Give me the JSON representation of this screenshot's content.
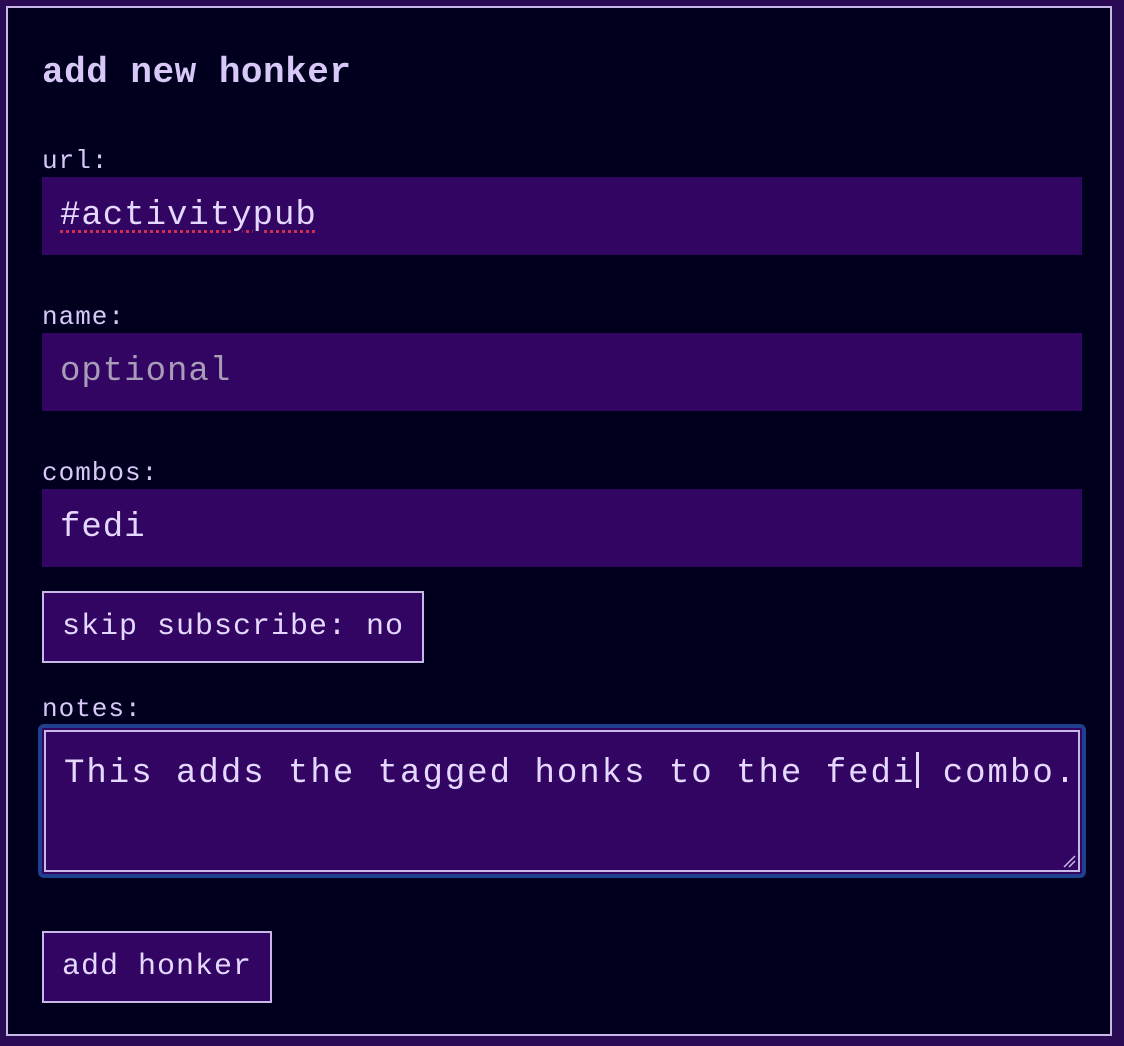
{
  "form": {
    "title": "add new honker",
    "url": {
      "label": "url:",
      "value": "#activitypub"
    },
    "name": {
      "label": "name:",
      "placeholder": "optional",
      "value": ""
    },
    "combos": {
      "label": "combos:",
      "value": "fedi"
    },
    "skip_subscribe_label": "skip subscribe: no",
    "notes": {
      "label": "notes:",
      "text_before_caret": "This adds the tagged honks to the fedi",
      "text_after_caret": " combo."
    },
    "submit_label": "add honker"
  },
  "colors": {
    "page_bg": "#2a0a52",
    "panel_bg": "#00001e",
    "field_bg": "#330562",
    "text": "#d8c8f8",
    "focus_ring": "#1f3f8f"
  }
}
